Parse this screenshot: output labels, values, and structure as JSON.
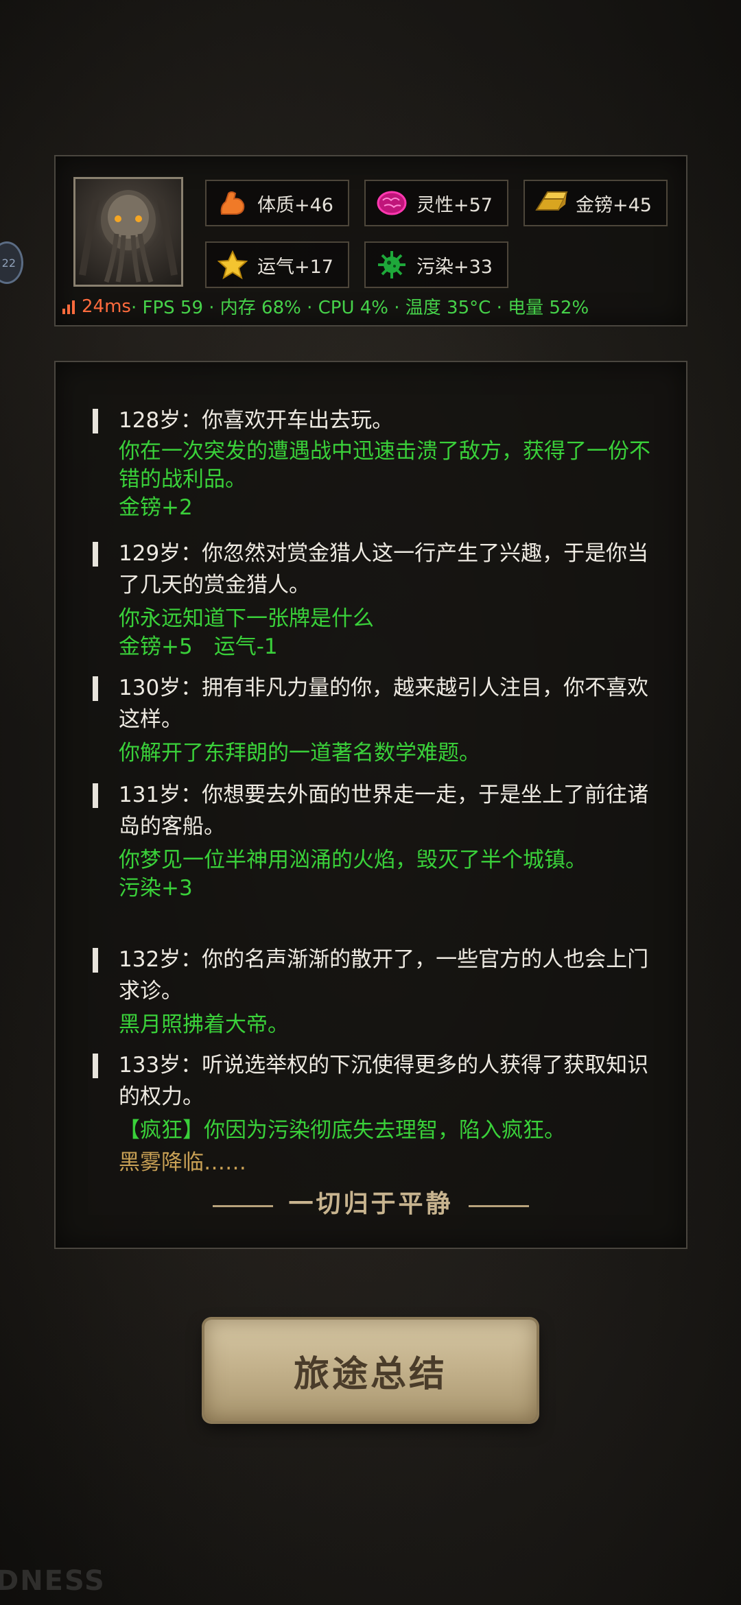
{
  "side_badge": "22",
  "stats": {
    "constitution": "体质+46",
    "spirit": "灵性+57",
    "gold": "金镑+45",
    "luck": "运气+17",
    "pollution": "污染+33"
  },
  "perf": {
    "ping": "24ms",
    "rest": " · FPS 59 · 内存 68% · CPU 4% · 温度 35°C · 电量 52%"
  },
  "log": [
    {
      "age": "128岁：你喜欢开车出去玩。",
      "event": "你在一次突发的遭遇战中迅速击溃了敌方，获得了一份不错的战利品。",
      "effect": "金镑+2"
    },
    {
      "age": "129岁：你忽然对赏金猎人这一行产生了兴趣，于是你当了几天的赏金猎人。",
      "event": "你永远知道下一张牌是什么",
      "effect": "金镑+5　运气-1"
    },
    {
      "age": "130岁：拥有非凡力量的你，越来越引人注目，你不喜欢这样。",
      "event": "你解开了东拜朗的一道著名数学难题。",
      "effect": ""
    },
    {
      "age": "131岁：你想要去外面的世界走一走，于是坐上了前往诸岛的客船。",
      "event": "你梦见一位半神用汹涌的火焰，毁灭了半个城镇。",
      "effect": "污染+3"
    },
    {
      "age": "132岁：你的名声渐渐的散开了，一些官方的人也会上门求诊。",
      "event": "黑月照拂着大帝。",
      "effect": ""
    },
    {
      "age": "133岁：听说选举权的下沉使得更多的人获得了获取知识的权力。",
      "event": "【疯狂】你因为污染彻底失去理智，陷入疯狂。",
      "effect": "",
      "ending_note": "黑雾降临……"
    }
  ],
  "ending": "一切归于平静",
  "summary_button": "旅途总结",
  "watermark": "DNESS",
  "colors": {
    "event": "#3ad13a",
    "gold_text": "#c8a055",
    "ping": "#ff6b3d"
  }
}
